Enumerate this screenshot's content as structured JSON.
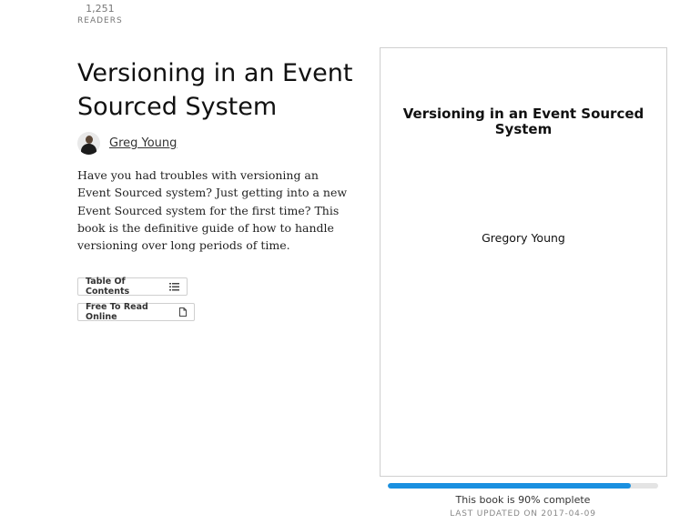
{
  "stats": {
    "readers_count": "1,251",
    "readers_label": "READERS"
  },
  "book": {
    "title": "Versioning in an Event Sourced System",
    "author": "Greg Young",
    "description": "Have you had troubles with versioning an Event Sourced system? Just getting into a new Event Sourced system for the first time? This book is the definitive guide of how to handle versioning over long periods of time."
  },
  "actions": {
    "toc_label": "Table Of Contents",
    "read_label": "Free To Read Online"
  },
  "cover": {
    "title": "Versioning in an Event Sourced System",
    "author": "Gregory Young"
  },
  "progress": {
    "percent": 90,
    "complete_text": "This book is 90% complete",
    "updated_text": "LAST UPDATED ON 2017-04-09"
  },
  "icons": [
    "list-icon",
    "document-icon",
    "avatar"
  ],
  "colors": {
    "progress_fill": "#1a90e0",
    "progress_track": "#e4e4e4"
  }
}
